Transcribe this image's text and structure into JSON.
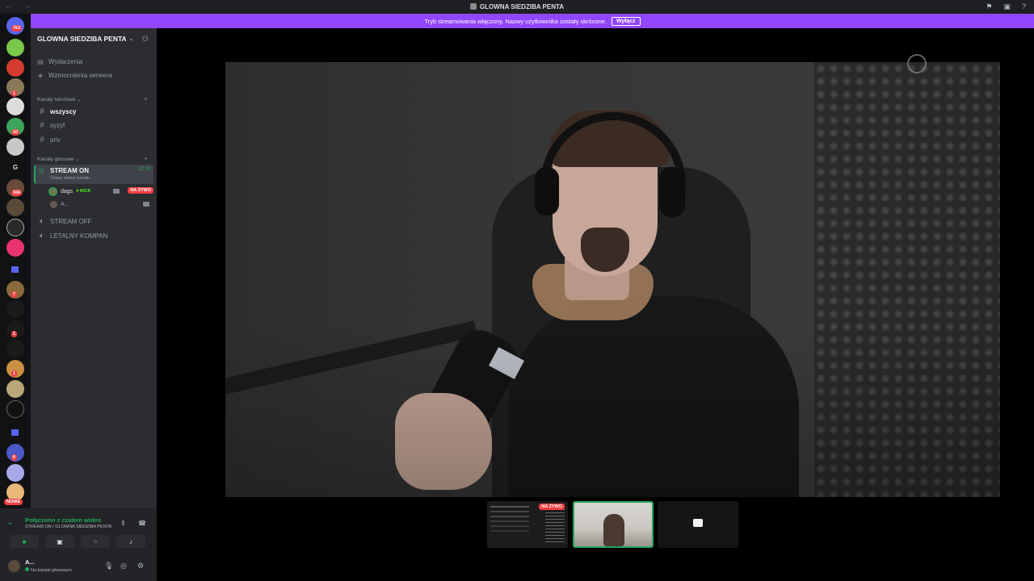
{
  "titlebar": {
    "title": "GLOWNA SIEDZIBA PENTA",
    "nav": "← →"
  },
  "banner": {
    "text": "Tryb streamowania włączony. Nazwy użytkownika zostały skrócone.",
    "button": "Wyłącz"
  },
  "rail": {
    "dm_badge": "763",
    "badge_2": "1",
    "badge_3": "10",
    "badge_4": "336",
    "letter_g": "G",
    "badge_5": "7",
    "badge_6": "1",
    "badge_7": "1",
    "badge_8": "6",
    "nowe": "NOWE"
  },
  "sidebar": {
    "server_name": "GLOWNA SIEDZIBA PENTA",
    "top_items": [
      "Wydarzenia",
      "Wzmocnienia serwera"
    ],
    "text_category": "Kanały tekstowe",
    "text_channels": [
      "wszyscy",
      "syzyf",
      "priv"
    ],
    "voice_category": "Kanały głosowe",
    "active_voice": {
      "name": "STREAM ON",
      "status": "Ustaw status kanału",
      "time": "22:39"
    },
    "members": [
      {
        "name": "dags",
        "tag": "KICK",
        "badge": "NA ŻYWO"
      },
      {
        "name": "A..."
      }
    ],
    "voice_channels": [
      "STREAM OFF",
      "LETALNY KOMPAN"
    ]
  },
  "voice_panel": {
    "title": "Połączono z czatem wideo",
    "subtitle": "STREAM ON / GLOWNA SIEDZIBA PENTA"
  },
  "user": {
    "name": "A...",
    "status": "Na kanale głosowym"
  },
  "thumbnails": {
    "live_badge": "NA ŻYWO"
  }
}
